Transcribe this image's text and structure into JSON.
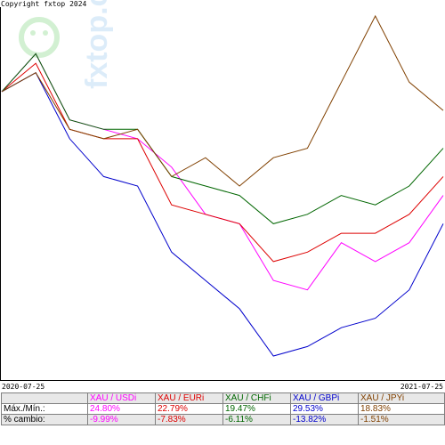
{
  "copyright": "Copyright fxtop 2024",
  "watermark": "fxtop.com",
  "chart_data": {
    "type": "line",
    "x_start_label": "2020-07-25",
    "x_end_label": "2021-07-25",
    "x": [
      0,
      4,
      8,
      12,
      16,
      20,
      24,
      28,
      32,
      36,
      40,
      44,
      48,
      52
    ],
    "series": [
      {
        "name": "XAU / USDi",
        "color": "#ff00ff",
        "values": [
          100,
          104,
          97,
          96,
          95,
          92,
          87,
          86,
          80,
          79,
          84,
          82,
          84,
          89
        ]
      },
      {
        "name": "XAU / EURi",
        "color": "#dd0000",
        "values": [
          100,
          103,
          96,
          95,
          95,
          88,
          87,
          86,
          82,
          83,
          85,
          85,
          87,
          91
        ]
      },
      {
        "name": "XAU / CHFi",
        "color": "#006600",
        "values": [
          100,
          104,
          97,
          96,
          96,
          91,
          90,
          89,
          86,
          87,
          89,
          88,
          90,
          94
        ]
      },
      {
        "name": "XAU / GBPi",
        "color": "#0000cc",
        "values": [
          100,
          102,
          95,
          91,
          90,
          83,
          80,
          77,
          72,
          73,
          75,
          76,
          79,
          86
        ]
      },
      {
        "name": "XAU / JPYi",
        "color": "#804000",
        "values": [
          100,
          102,
          96,
          95,
          96,
          91,
          93,
          90,
          93,
          94,
          101,
          108,
          101,
          98
        ]
      }
    ]
  },
  "table": {
    "header_blank": "",
    "columns": [
      {
        "label": "XAU / USDi",
        "color": "#ff00ff"
      },
      {
        "label": "XAU / EURi",
        "color": "#dd0000"
      },
      {
        "label": "XAU / CHFi",
        "color": "#006600"
      },
      {
        "label": "XAU / GBPi",
        "color": "#0000cc"
      },
      {
        "label": "XAU / JPYi",
        "color": "#804000"
      }
    ],
    "rows": [
      {
        "label": "Máx./Mín.:",
        "values": [
          "24.80%",
          "22.79%",
          "19.47%",
          "29.53%",
          "18.83%"
        ]
      },
      {
        "label": "% cambio:",
        "values": [
          "-9.99%",
          "-7.83%",
          "-6.11%",
          "-13.82%",
          "-1.51%"
        ]
      }
    ]
  }
}
